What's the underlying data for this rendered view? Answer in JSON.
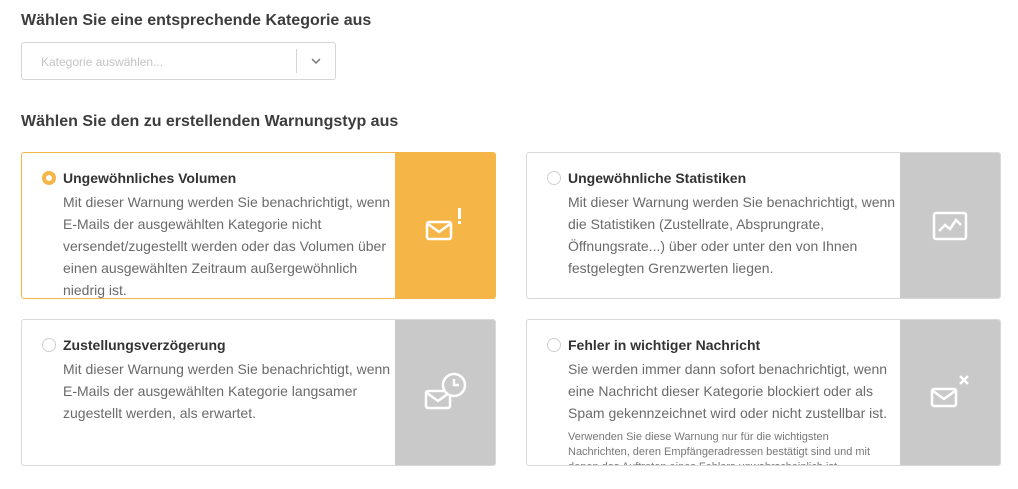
{
  "category_section": {
    "title": "Wählen Sie eine entsprechende Kategorie aus",
    "select_placeholder": "Kategorie auswählen..."
  },
  "type_section": {
    "title": "Wählen Sie den zu erstellenden Warnungstyp aus"
  },
  "cards": [
    {
      "title": "Ungewöhnliches Volumen",
      "description": "Mit dieser Warnung werden Sie benachrichtigt, wenn E-Mails der ausgewählten Kategorie nicht versendet/zugestellt werden oder das Volumen über einen ausgewählten Zeitraum außergewöhnlich niedrig ist.",
      "icon": "mail-alert-icon",
      "selected": true
    },
    {
      "title": "Ungewöhnliche Statistiken",
      "description": "Mit dieser Warnung werden Sie benachrichtigt, wenn die Statistiken (Zustellrate, Absprungrate, Öffnungsrate...) über oder unter den von Ihnen festgelegten Grenzwerten liegen.",
      "icon": "chart-icon",
      "selected": false
    },
    {
      "title": "Zustellungsverzögerung",
      "description": "Mit dieser Warnung werden Sie benachrichtigt, wenn E-Mails der ausgewählten Kategorie langsamer zugestellt werden, als erwartet.",
      "icon": "mail-clock-icon",
      "selected": false
    },
    {
      "title": "Fehler in wichtiger Nachricht",
      "description": "Sie werden immer dann sofort benachrichtigt, wenn eine Nachricht dieser Kategorie blockiert oder als Spam gekennzeichnet wird oder nicht zustellbar ist.",
      "note": "Verwenden Sie diese Warnung nur für die wichtigsten Nachrichten, deren Empfängeradressen bestätigt sind und mit denen das Auftreten eines Fehlers unwahrscheinlich ist.",
      "icon": "mail-error-icon",
      "selected": false
    }
  ],
  "colors": {
    "accent": "#f5b547",
    "icon_panel_inactive": "#c9c9c9",
    "border": "#d8d8d8"
  }
}
